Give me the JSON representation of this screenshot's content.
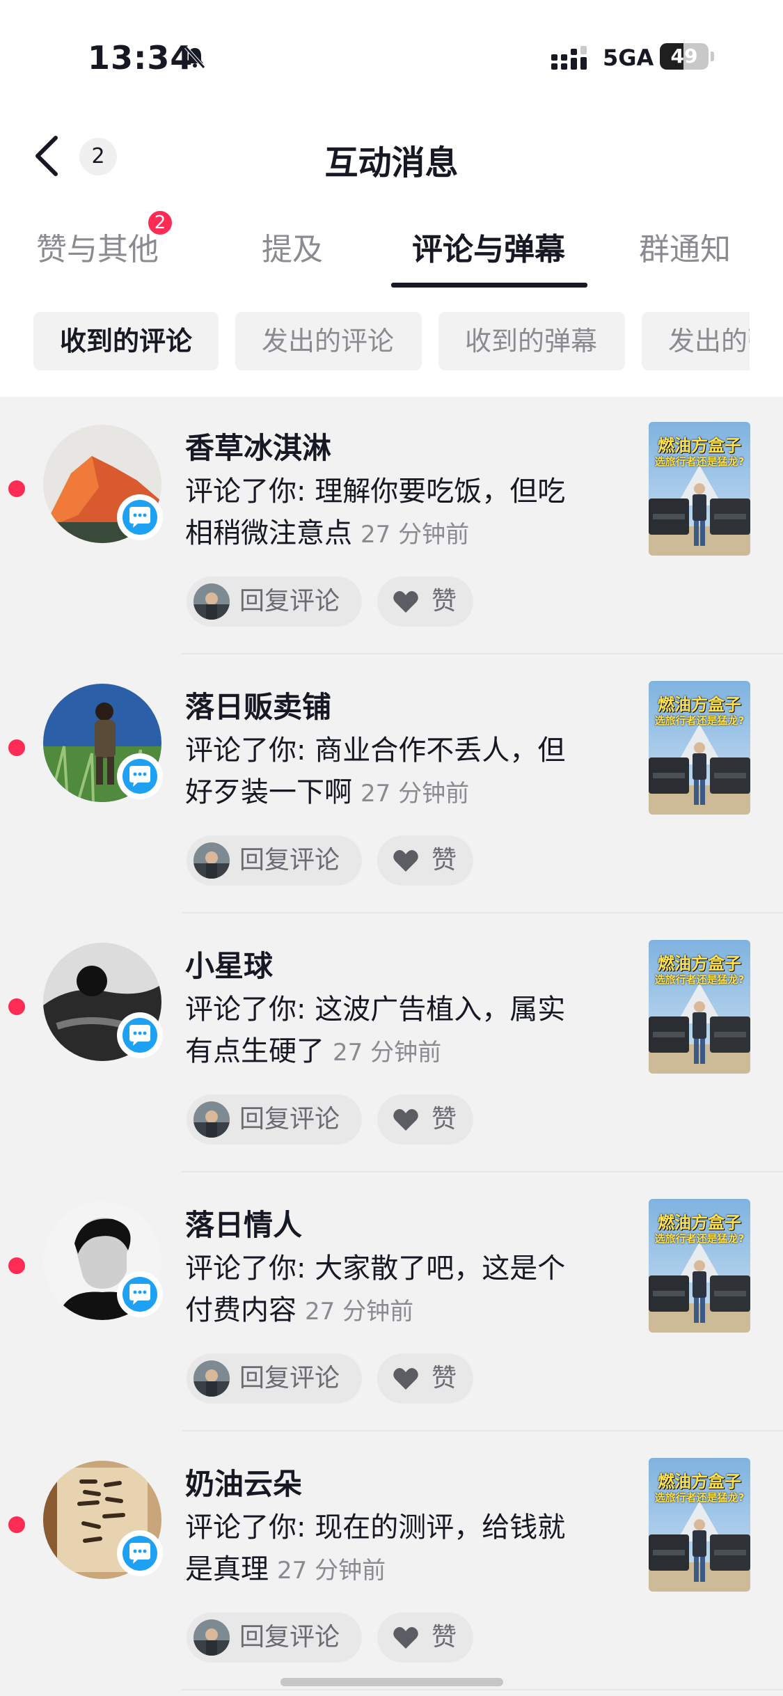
{
  "status_bar": {
    "time": "13:34",
    "network": "5GA",
    "battery_level": "49",
    "battery_fraction": 0.49
  },
  "header": {
    "back_count": "2",
    "title": "互动消息"
  },
  "tabs": [
    {
      "label": "赞与其他",
      "badge": "2",
      "active": false
    },
    {
      "label": "提及",
      "active": false
    },
    {
      "label": "评论与弹幕",
      "active": true
    },
    {
      "label": "群通知",
      "active": false
    }
  ],
  "filters": [
    {
      "label": "收到的评论",
      "active": true
    },
    {
      "label": "发出的评论",
      "active": false
    },
    {
      "label": "收到的弹幕",
      "active": false
    },
    {
      "label": "发出的弹幕",
      "active": false
    }
  ],
  "actions": {
    "reply_label": "回复评论",
    "like_label": "赞"
  },
  "video_thumb": {
    "title": "燃油方盒子",
    "subtitle": "选旅行者还是猛龙?"
  },
  "notifications": [
    {
      "username": "香草冰淇淋",
      "text": "评论了你: 理解你要吃饭，但吃相稍微注意点",
      "time": "27 分钟前"
    },
    {
      "username": "落日贩卖铺",
      "text": "评论了你: 商业合作不丢人，但好歹装一下啊",
      "time": "27 分钟前"
    },
    {
      "username": "小星球",
      "text": "评论了你: 这波广告植入，属实有点生硬了",
      "time": "27 分钟前"
    },
    {
      "username": "落日情人",
      "text": "评论了你: 大家散了吧，这是个付费内容",
      "time": "27 分钟前"
    },
    {
      "username": "奶油云朵",
      "text": "评论了你: 现在的测评，给钱就是真理",
      "time": "27 分钟前"
    }
  ],
  "colors": {
    "accent_red": "#fe2c55",
    "comment_blue": "#1ea1f2",
    "text_primary": "#161823",
    "text_secondary": "#8a8b91"
  }
}
